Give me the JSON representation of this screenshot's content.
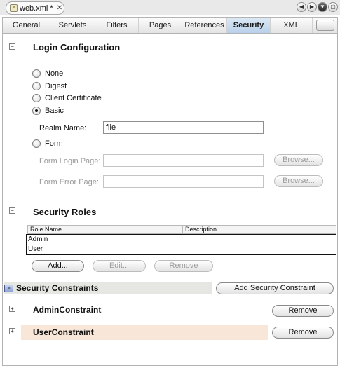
{
  "editor_tab": {
    "filename": "web.xml *",
    "close_glyph": "✕"
  },
  "nav": {
    "left": "◀",
    "right": "▶",
    "down": "▼",
    "max": "▢"
  },
  "view_tabs": [
    "General",
    "Servlets",
    "Filters",
    "Pages",
    "References",
    "Security",
    "XML"
  ],
  "active_view_tab": "Security",
  "login": {
    "title": "Login Configuration",
    "collapse_glyph": "−",
    "options": [
      "None",
      "Digest",
      "Client Certificate",
      "Basic",
      "Form"
    ],
    "selected": "Basic",
    "realm_label": "Realm Name:",
    "realm_value": "file",
    "form_login_label": "Form Login Page:",
    "form_error_label": "Form Error Page:",
    "browse_label": "Browse..."
  },
  "roles": {
    "title": "Security Roles",
    "collapse_glyph": "−",
    "columns": [
      "Role Name",
      "Description"
    ],
    "rows": [
      "Admin",
      "User"
    ],
    "add_label": "Add...",
    "edit_label": "Edit...",
    "remove_label": "Remove"
  },
  "constraints": {
    "title": "Security Constraints",
    "add_label": "Add Security Constraint",
    "expand_glyph": "+",
    "items": [
      {
        "name": "AdminConstraint",
        "remove_label": "Remove"
      },
      {
        "name": "UserConstraint",
        "remove_label": "Remove"
      }
    ]
  },
  "colors": {
    "active_tab": "#b8d0ea",
    "selected_constraint_bg": "#f8e6d8",
    "section_bar": "#e6e6e2"
  }
}
